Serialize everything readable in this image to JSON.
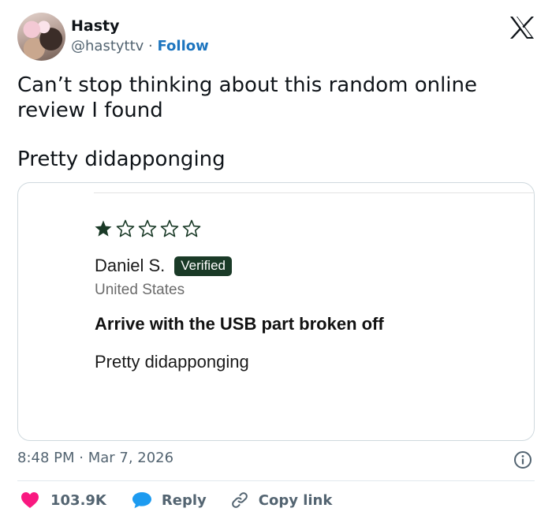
{
  "author": {
    "display_name": "Hasty",
    "handle": "@hastyttv",
    "separator": " · ",
    "follow_label": "Follow"
  },
  "tweet": {
    "text_lines": [
      "Can’t stop thinking about this random online review I found",
      "Pretty didapponging"
    ]
  },
  "review": {
    "rating": 1,
    "max_rating": 5,
    "reviewer_name": "Daniel S.",
    "verified_label": "Verified",
    "location": "United States",
    "title": "Arrive with the USB part broken off",
    "body": "Pretty didapponging",
    "accent_color": "#1a3a27"
  },
  "meta": {
    "timestamp": "8:48 PM · Mar 7, 2026"
  },
  "actions": {
    "like_count": "103.9K",
    "reply_label": "Reply",
    "copy_link_label": "Copy link"
  },
  "icons": {
    "brand": "x-logo-icon",
    "info": "info-icon",
    "like": "heart-icon",
    "reply": "speech-bubble-icon",
    "copy": "link-icon"
  },
  "colors": {
    "follow": "#1d75bf",
    "heart": "#f91880",
    "reply": "#1d9bf0",
    "muted": "#536471"
  }
}
